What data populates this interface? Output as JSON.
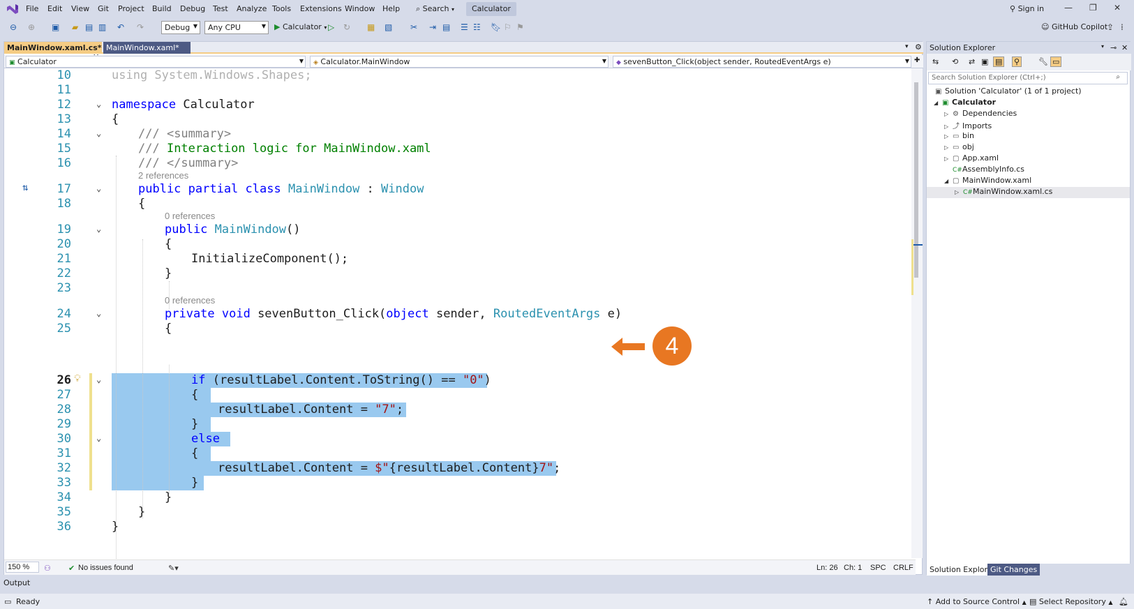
{
  "menu": {
    "items": [
      "File",
      "Edit",
      "View",
      "Git",
      "Project",
      "Build",
      "Debug",
      "Test",
      "Analyze",
      "Tools",
      "Extensions",
      "Window",
      "Help"
    ],
    "search_label": "Search",
    "solution_title": "Calculator",
    "sign_in": "Sign in"
  },
  "toolbar": {
    "config": "Debug",
    "platform": "Any CPU",
    "run_target": "Calculator",
    "copilot": "GitHub Copilot"
  },
  "editor": {
    "tabs": [
      {
        "label": "MainWindow.xaml.cs*",
        "active": true
      },
      {
        "label": "MainWindow.xaml*",
        "active": false
      }
    ],
    "nav": {
      "project": "Calculator",
      "class": "Calculator.MainWindow",
      "member": "sevenButton_Click(object sender, RoutedEventArgs e)"
    },
    "line_numbers": [
      "10",
      "11",
      "12",
      "13",
      "14",
      "15",
      "16",
      "17",
      "18",
      "19",
      "20",
      "21",
      "22",
      "23",
      "24",
      "25",
      "26",
      "27",
      "28",
      "29",
      "30",
      "31",
      "32",
      "33",
      "34",
      "35",
      "36"
    ],
    "code": {
      "l10_using": "using System.Windows.Shapes;",
      "l12_ns_kw": "namespace",
      "l12_ns": " Calculator",
      "l13": "{",
      "l14_a": "/// ",
      "l14_b": "<summary>",
      "l15_a": "/// ",
      "l15_b": "Interaction logic for MainWindow.xaml",
      "l16_a": "/// ",
      "l16_b": "</summary>",
      "lens_class": "2 references",
      "l17_kw": "public partial class",
      "l17_name": "MainWindow",
      "l17_sep": " : ",
      "l17_base": "Window",
      "l18": "{",
      "lens_ctor": "0 references",
      "l19_kw": "public",
      "l19_name": "MainWindow",
      "l19_rest": "()",
      "l20": "{",
      "l21": "InitializeComponent();",
      "l22": "}",
      "lens_method": "0 references",
      "l24_kw": "private void",
      "l24_name": " sevenButton_Click(",
      "l24_kw2": "object",
      "l24_p1": " sender, ",
      "l24_ty": "RoutedEventArgs",
      "l24_p2": " e)",
      "l25": "{",
      "l26_kw": "if",
      "l26_rest": " (resultLabel.Content.ToString() == ",
      "l26_str": "\"0\"",
      "l26_end": ")",
      "l27": "{",
      "l28_a": "resultLabel.Content = ",
      "l28_str": "\"7\"",
      "l28_end": ";",
      "l29": "}",
      "l30_kw": "else",
      "l31": "{",
      "l32_a": "resultLabel.Content = ",
      "l32_b": "$\"",
      "l32_c": "{resultLabel.Content}",
      "l32_d": "7\"",
      "l32_end": ";",
      "l33": "}",
      "l34": "}",
      "l35": "}",
      "l36": "}"
    },
    "status": {
      "zoom": "150 %",
      "issues": "No issues found",
      "line": "Ln: 26",
      "col": "Ch: 1",
      "spc": "SPC",
      "eol": "CRLF"
    }
  },
  "solution_explorer": {
    "title": "Solution Explorer",
    "search_placeholder": "Search Solution Explorer (Ctrl+;)",
    "items": [
      {
        "label": "Solution 'Calculator' (1 of 1 project)"
      },
      {
        "label": "Calculator"
      },
      {
        "label": "Dependencies"
      },
      {
        "label": "Imports"
      },
      {
        "label": "bin"
      },
      {
        "label": "obj"
      },
      {
        "label": "App.xaml"
      },
      {
        "label": "AssemblyInfo.cs"
      },
      {
        "label": "MainWindow.xaml"
      },
      {
        "label": "MainWindow.xaml.cs"
      }
    ],
    "bottom_tabs": [
      "Solution Explorer",
      "Git Changes"
    ]
  },
  "output_label": "Output",
  "statusbar": {
    "ready": "Ready",
    "source_control": "Add to Source Control",
    "repository": "Select Repository"
  },
  "annotation": {
    "step": "4",
    "color": "#e87722"
  }
}
